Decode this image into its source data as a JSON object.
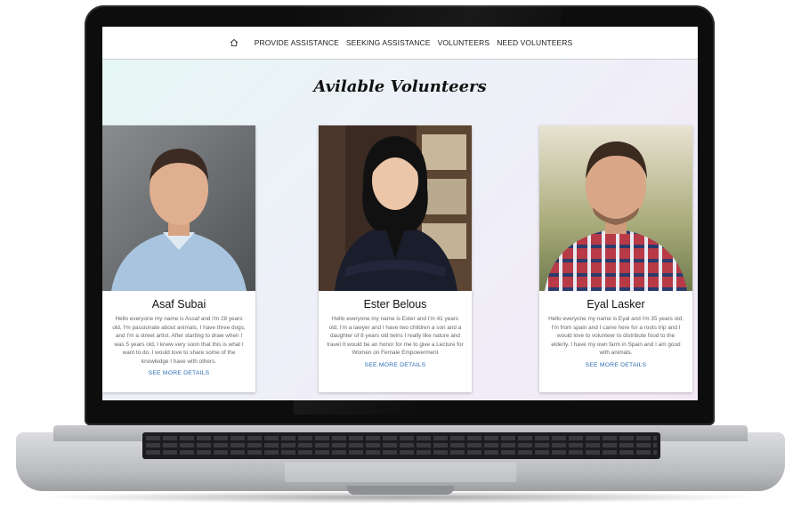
{
  "nav": {
    "home_icon": "home-icon",
    "links": [
      "PROVIDE ASSISTANCE",
      "SEEKING ASSISTANCE",
      "VOLUNTEERS",
      "NEED VOLUNTEERS"
    ]
  },
  "page": {
    "title": "Avilable Volunteers"
  },
  "volunteers": [
    {
      "name": "Asaf Subai",
      "bio": "Hello everyone my name is Assaf and i'm 28 years old, I'm passionate about animals, I have three dogs, and I'm a street artist. After starting to draw when I was 5 years old, I knew very soon that this is what I want to do. I would love to share some of the knowledge I have with others.",
      "more": "SEE MORE DETAILS"
    },
    {
      "name": "Ester Belous",
      "bio": "Hello everyone my name is Ester and i'm 41 years old, I'm a lawyer and I have two children a son and a daughter of 8 years old twins I really like nature and travel It would be an honor for me to give a Lecture for Women on Female Empowerment",
      "more": "SEE MORE DETAILS"
    },
    {
      "name": "Eyal Lasker",
      "bio": "Hello everyone my name is Eyal and i'm 35 years old, I'm from spain and I came here for a roots trip and I would love to volunteer to distribute food to the elderly. I have my own farm in Spain and I am good with animals.",
      "more": "SEE MORE DETAILS"
    }
  ],
  "colors": {
    "link": "#2d6cb5",
    "laptop_body": "#0d0d0d"
  }
}
